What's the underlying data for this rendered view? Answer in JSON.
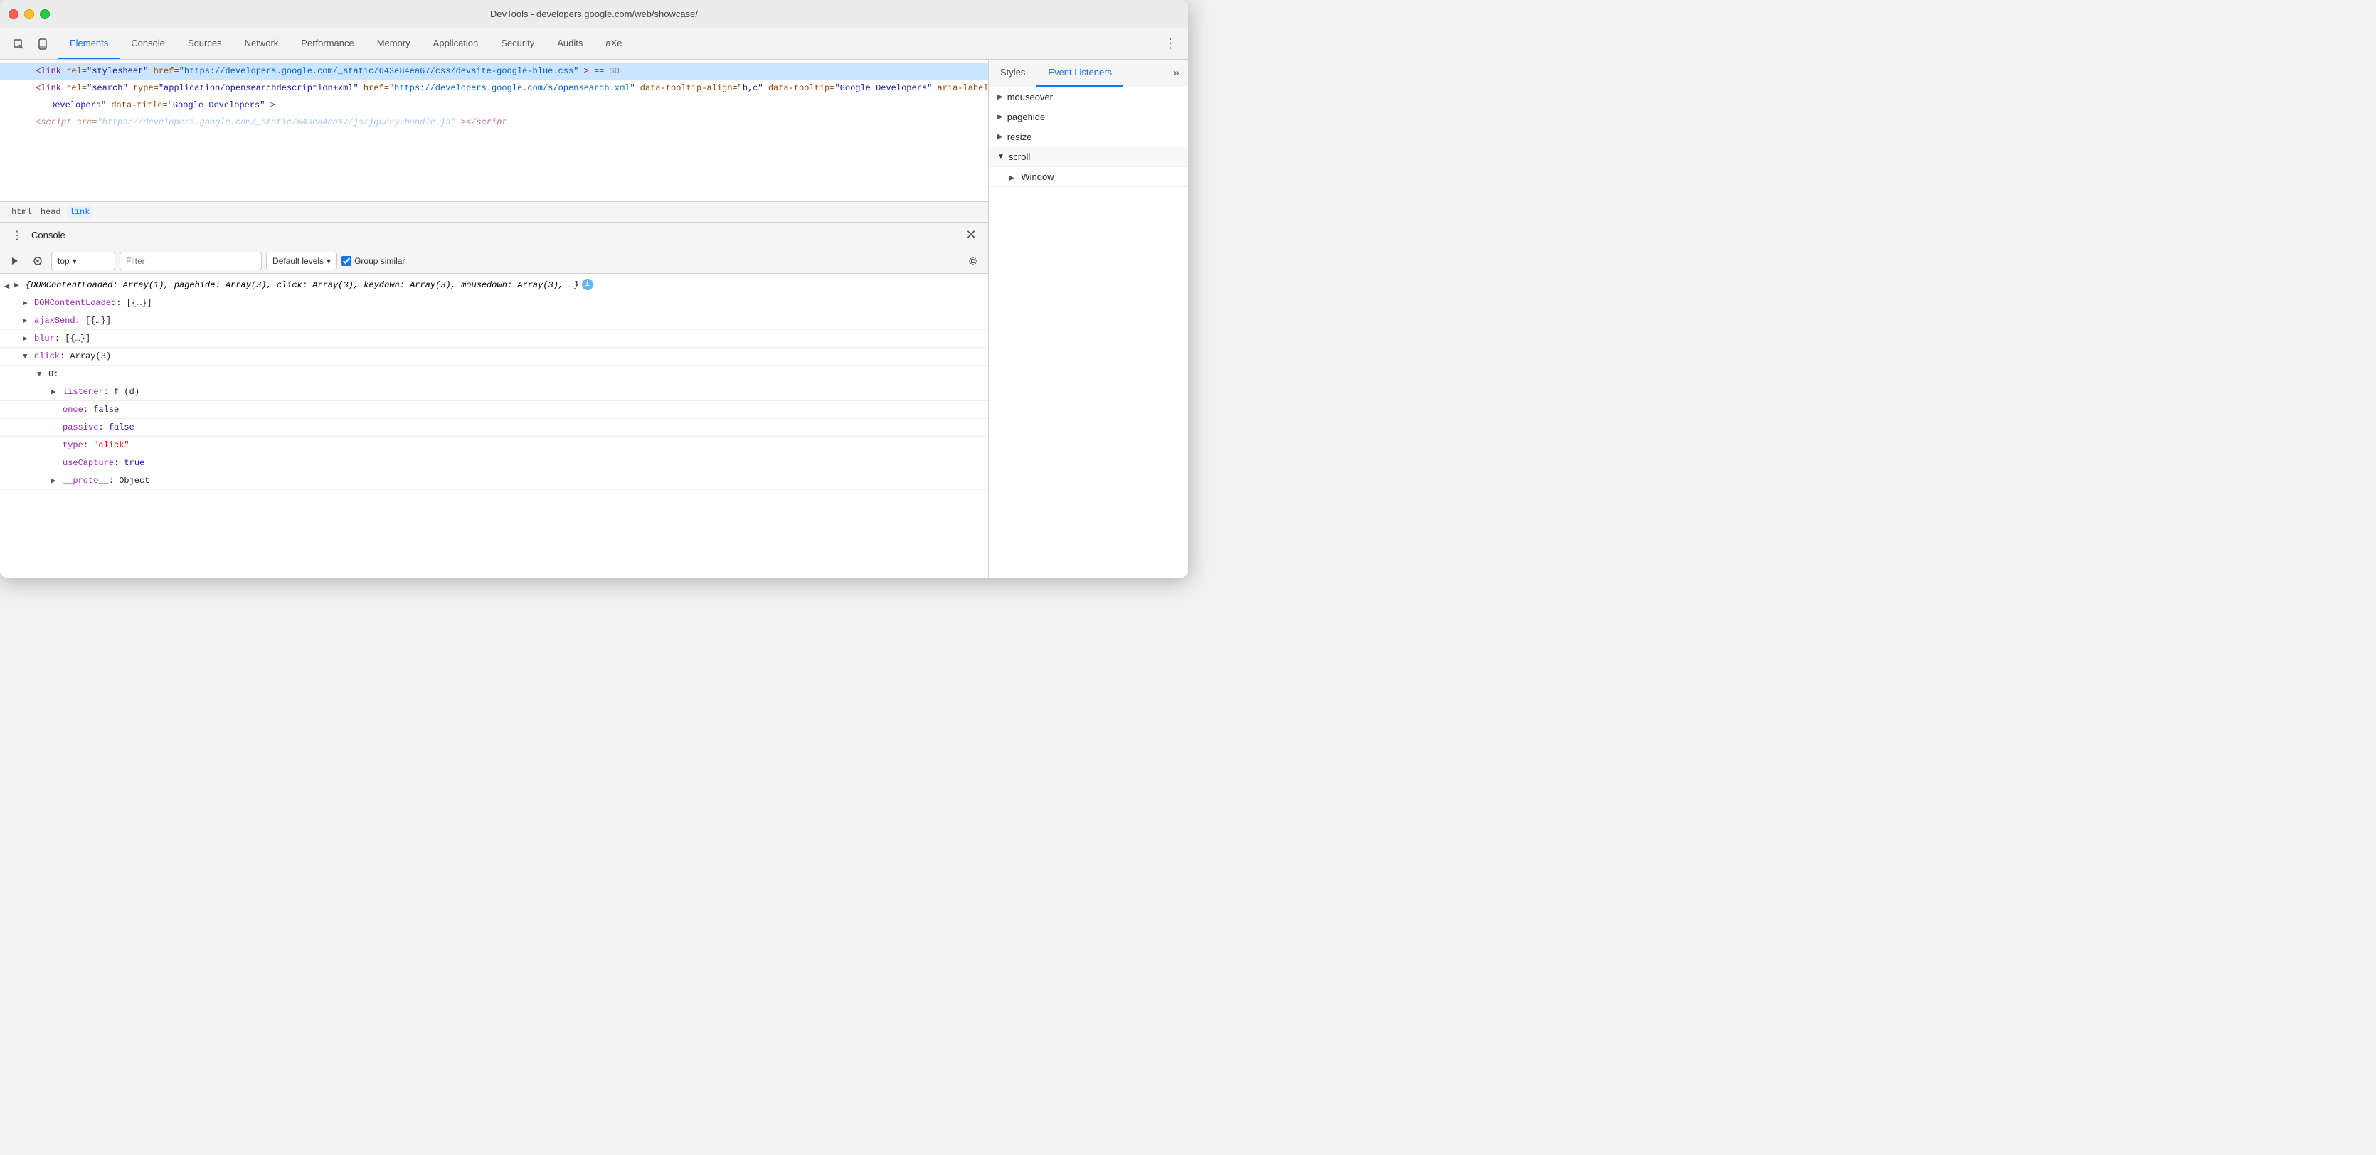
{
  "window": {
    "title": "DevTools - developers.google.com/web/showcase/"
  },
  "tabs": {
    "items": [
      {
        "label": "Elements",
        "active": true
      },
      {
        "label": "Console"
      },
      {
        "label": "Sources"
      },
      {
        "label": "Network"
      },
      {
        "label": "Performance"
      },
      {
        "label": "Memory"
      },
      {
        "label": "Application"
      },
      {
        "label": "Security"
      },
      {
        "label": "Audits"
      },
      {
        "label": "aXe"
      }
    ]
  },
  "elements": {
    "lines": [
      {
        "type": "link-selected",
        "content": "<link rel=\"stylesheet\" href=\"https://developers.google.com/_static/643e84ea67/css/devsite-google-blue.css\"> == $0"
      },
      {
        "type": "link",
        "content": "<link rel=\"search\" type=\"application/opensearchdescription+xml\" href=\"https://developers.google.com/s/opensearch.xml\" data-tooltip-align=\"b,c\" data-tooltip=\"Google Developers\" aria-label=\"Google Developers\" data-title=\"Google Developers\">"
      },
      {
        "type": "script-truncated",
        "content": "<script src=\"https://developers.google.com/_static/643e84ea67/js/jquery.bundle.js\"></script"
      }
    ]
  },
  "breadcrumb": {
    "items": [
      {
        "label": "html",
        "active": false
      },
      {
        "label": "head",
        "active": false
      },
      {
        "label": "link",
        "active": true
      }
    ]
  },
  "console": {
    "title": "Console",
    "toolbar": {
      "context": "top",
      "filter_placeholder": "Filter",
      "levels": "Default levels",
      "group_similar": "Group similar"
    },
    "output": {
      "main_object": "{DOMContentLoaded: Array(1), pagehide: Array(3), click: Array(3), keydown: Array(3), mousedown: Array(3), …}",
      "items": [
        {
          "label": "DOMContentLoaded: [{…}]",
          "expanded": false
        },
        {
          "label": "ajaxSend: [{…}]",
          "expanded": false
        },
        {
          "label": "blur: [{…}]",
          "expanded": false
        },
        {
          "label": "click: Array(3)",
          "expanded": true
        },
        {
          "label": "0:",
          "expanded": true,
          "indent": 1
        },
        {
          "label": "listener: f (d)",
          "expanded": false,
          "indent": 2
        },
        {
          "label": "once: false",
          "indent": 2,
          "key": "once",
          "value": "false"
        },
        {
          "label": "passive: false",
          "indent": 2,
          "key": "passive",
          "value": "false"
        },
        {
          "label": "type: \"click\"",
          "indent": 2,
          "key": "type",
          "value": "\"click\""
        },
        {
          "label": "useCapture: true",
          "indent": 2,
          "key": "useCapture",
          "value": "true"
        },
        {
          "label": "__proto__: Object",
          "expanded": false,
          "indent": 2
        }
      ]
    }
  },
  "right_panel": {
    "tabs": [
      {
        "label": "Styles",
        "active": false
      },
      {
        "label": "Event Listeners",
        "active": true
      }
    ],
    "events": [
      {
        "label": "mouseover",
        "expanded": false
      },
      {
        "label": "pagehide",
        "expanded": false
      },
      {
        "label": "resize",
        "expanded": false
      },
      {
        "label": "scroll",
        "expanded": true,
        "children": [
          {
            "label": "Window"
          }
        ]
      }
    ]
  }
}
